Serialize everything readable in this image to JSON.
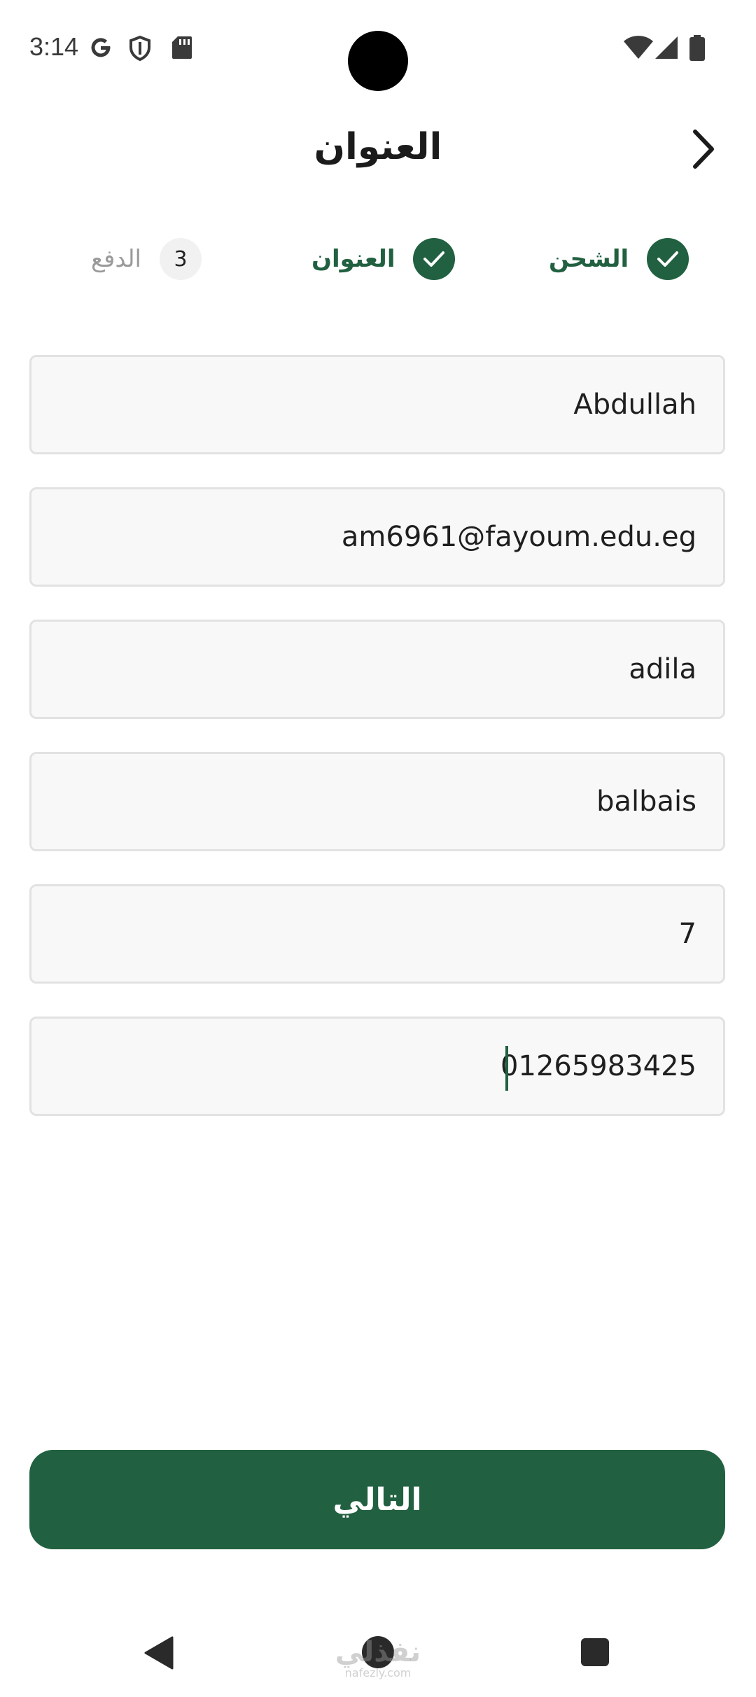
{
  "status_bar": {
    "time": "3:14",
    "left_icons": [
      "google-g-icon",
      "shield-icon",
      "sd-card-icon"
    ],
    "right_icons": [
      "wifi-icon",
      "signal-icon",
      "battery-icon"
    ]
  },
  "app_bar": {
    "title": "العنوان",
    "back_icon": "chevron-right-icon"
  },
  "stepper": {
    "steps": [
      {
        "label": "الشحن",
        "state": "done"
      },
      {
        "label": "العنوان",
        "state": "done"
      },
      {
        "label": "الدفع",
        "number": "3",
        "state": "pending"
      }
    ]
  },
  "form": {
    "fields": [
      {
        "value": "Abdullah"
      },
      {
        "value": "am6961@fayoum.edu.eg"
      },
      {
        "value": "adila"
      },
      {
        "value": "balbais"
      },
      {
        "value": "7"
      },
      {
        "value": "01265983425",
        "focused": true
      }
    ]
  },
  "next_button": {
    "label": "التالي"
  },
  "watermark": {
    "text": "نفذلي",
    "domain": "nafezly.com"
  },
  "colors": {
    "primary": "#216040",
    "field_bg": "#f8f8f8",
    "field_border": "#e2e2e2"
  }
}
